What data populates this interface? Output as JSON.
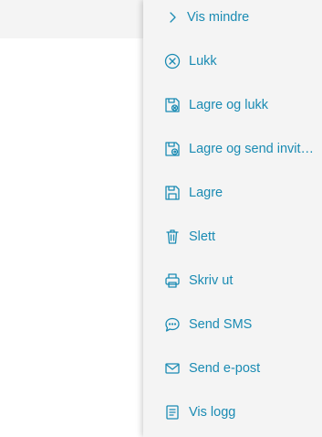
{
  "menu": {
    "items": [
      {
        "label": "Vis mindre",
        "icon": "chevron-right-icon"
      },
      {
        "label": "Lukk",
        "icon": "close-circle-icon"
      },
      {
        "label": "Lagre og lukk",
        "icon": "save-close-icon"
      },
      {
        "label": "Lagre og send invitasjon",
        "icon": "save-send-icon"
      },
      {
        "label": "Lagre",
        "icon": "save-icon"
      },
      {
        "label": "Slett",
        "icon": "trash-icon"
      },
      {
        "label": "Skriv ut",
        "icon": "printer-icon"
      },
      {
        "label": "Send SMS",
        "icon": "chat-bubble-icon"
      },
      {
        "label": "Send e-post",
        "icon": "envelope-icon"
      },
      {
        "label": "Vis logg",
        "icon": "document-log-icon"
      }
    ]
  },
  "colors": {
    "accent": "#1a8bb3",
    "menu_background": "#f4f4f4",
    "page_background": "#ffffff"
  }
}
